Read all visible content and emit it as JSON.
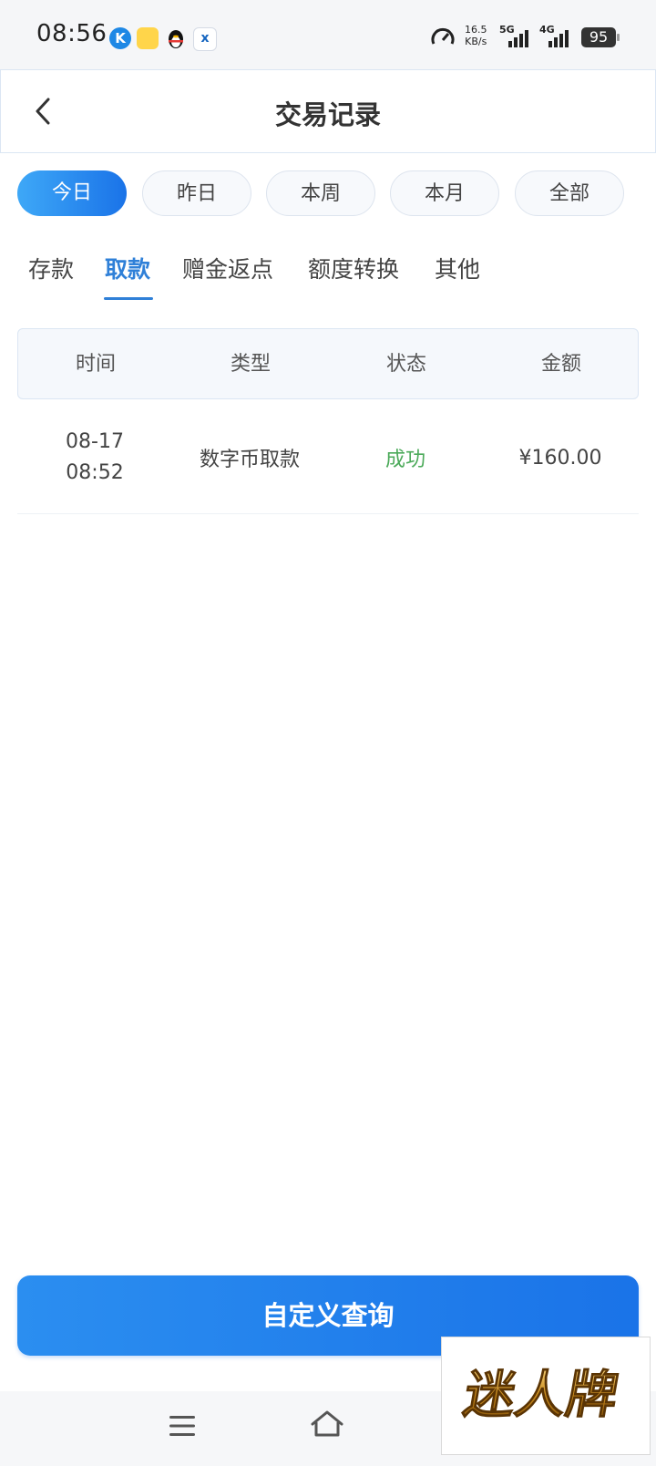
{
  "status_bar": {
    "time": "08:56",
    "net_speed": "16.5",
    "net_unit": "KB/s",
    "sim1": "5G",
    "sim2": "4G",
    "battery": "95",
    "app_icons": [
      "k-app-icon",
      "notes-app-icon",
      "qq-penguin-icon",
      "x-app-icon"
    ]
  },
  "header": {
    "title": "交易记录",
    "back_icon": "chevron-left-icon"
  },
  "periods": [
    {
      "label": "今日",
      "active": true
    },
    {
      "label": "昨日",
      "active": false
    },
    {
      "label": "本周",
      "active": false
    },
    {
      "label": "本月",
      "active": false
    },
    {
      "label": "全部",
      "active": false
    }
  ],
  "categories": [
    {
      "label": "存款",
      "active": false
    },
    {
      "label": "取款",
      "active": true
    },
    {
      "label": "赠金返点",
      "active": false
    },
    {
      "label": "额度转换",
      "active": false
    },
    {
      "label": "其他",
      "active": false
    }
  ],
  "table": {
    "columns": [
      "时间",
      "类型",
      "状态",
      "金额"
    ],
    "rows": [
      {
        "date": "08-17",
        "time": "08:52",
        "type": "数字币取款",
        "status": "成功",
        "amount": "¥160.00"
      }
    ]
  },
  "query_button": "自定义查询",
  "nav": {
    "menu_icon": "menu-icon",
    "home_icon": "home-icon"
  },
  "watermark": {
    "text": "迷人牌"
  },
  "colors": {
    "accent": "#1a73e8",
    "tab_active": "#2f80d8",
    "success": "#4caa5a"
  }
}
